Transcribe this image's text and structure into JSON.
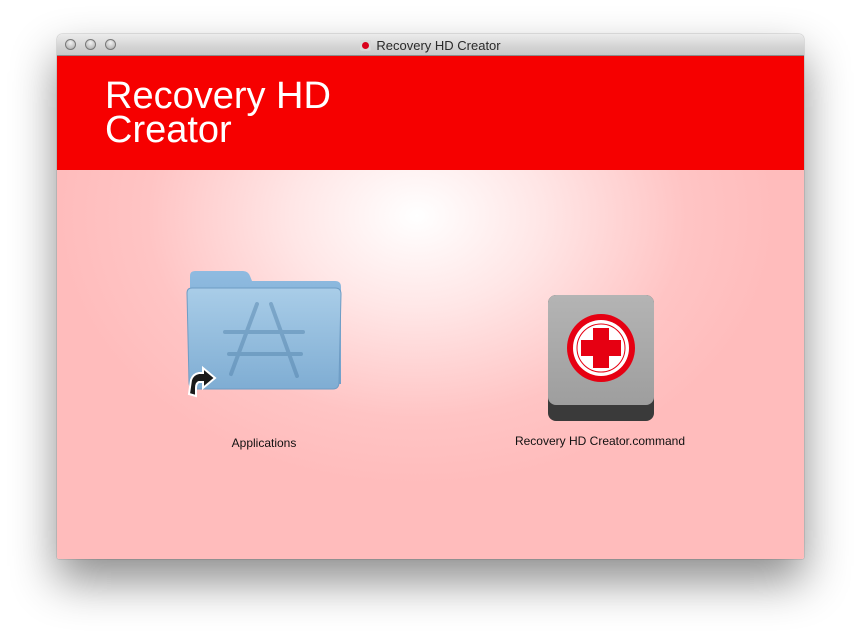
{
  "window": {
    "title": "Recovery HD Creator"
  },
  "banner": {
    "title_line1": "Recovery HD",
    "title_line2": "Creator",
    "color": "#f60000"
  },
  "items": [
    {
      "label": "Applications",
      "icon": "applications-folder-alias-icon"
    },
    {
      "label": "Recovery HD Creator.command",
      "icon": "recovery-command-icon"
    }
  ]
}
